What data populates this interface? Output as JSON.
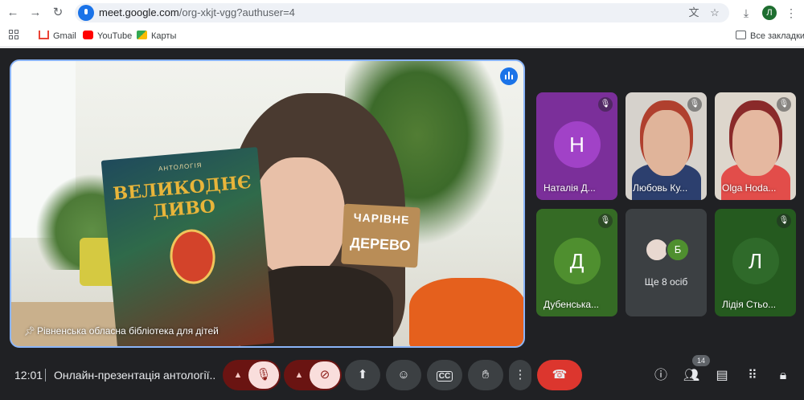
{
  "browser": {
    "url_host": "meet.google.com",
    "url_path": "/org-xkjt-vgg?authuser=4",
    "profile_initial": "Л",
    "bookmarks": [
      {
        "label": "Gmail"
      },
      {
        "label": "YouTube"
      },
      {
        "label": "Карты"
      }
    ],
    "all_bookmarks_label": "Все закладки"
  },
  "stage": {
    "presenter_label": "Рівненська обласна бібліотека для дітей",
    "book_subtitle": "АНТОЛОГІЯ",
    "book_title": "ВЕЛИКОДНЄ ДИВО",
    "sign_top": "ЧАРІВНЕ",
    "sign_bottom": "ДЕРЕВО"
  },
  "tiles": [
    {
      "name": "Наталія Д...",
      "initial": "Н",
      "color": "#a142c7"
    },
    {
      "name": "Любовь Ку..."
    },
    {
      "name": "Olga Hoda..."
    },
    {
      "name": "Дубенська...",
      "initial": "Д",
      "color": "#4f8f2f"
    },
    {
      "more_label": "Ще 8 осіб",
      "initial": "Б"
    },
    {
      "name": "Лідія Стьо...",
      "initial": "Л",
      "color": "#2f6a2a"
    }
  ],
  "bottom": {
    "time": "12:01",
    "meeting_title": "Онлайн-презентація антології...",
    "people_count": "14"
  },
  "colors": {
    "accent": "#8ab4f8",
    "hangup": "#dc362e",
    "tile_bg": "#3c4043"
  }
}
